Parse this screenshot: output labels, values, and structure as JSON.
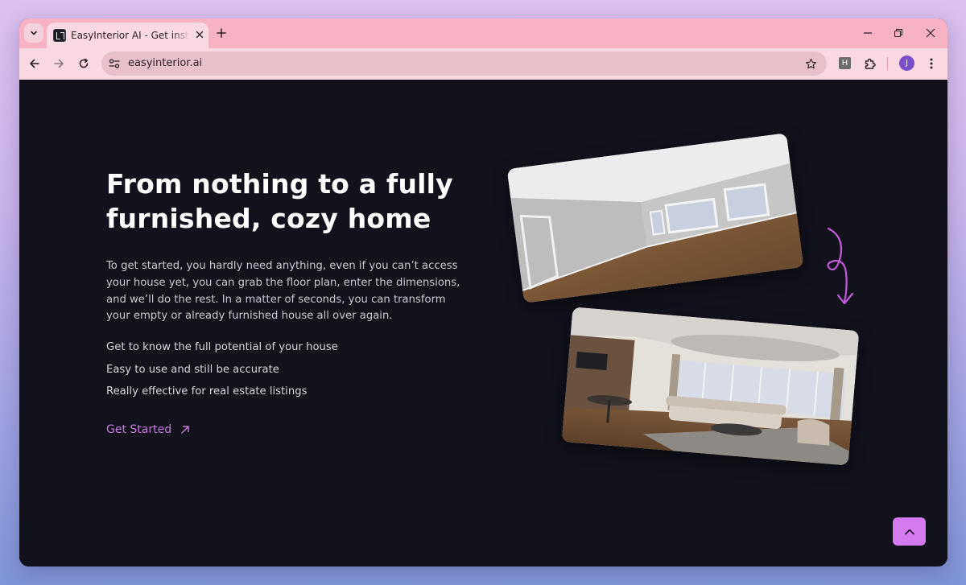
{
  "browser": {
    "tab": {
      "title": "EasyInterior AI - Get instant interior design"
    },
    "address_bar": {
      "url": "easyinterior.ai"
    },
    "extension_label": "H",
    "profile_initial": "J"
  },
  "hero": {
    "title": "From nothing to a fully furnished, cozy home",
    "description": "To get started, you hardly need anything, even if you can’t access your house yet, you can grab the floor plan, enter the dimensions, and we’ll do the rest. In a matter of seconds, you can transform your empty or already furnished house all over again.",
    "features": [
      "Get to know the full potential of your house",
      "Easy to use and still be accurate",
      "Really effective for real estate listings"
    ],
    "cta_label": "Get Started"
  },
  "colors": {
    "page_background": "#12121d",
    "accent": "#c77ae0",
    "scroll_top_button": "#d57bf0",
    "tab_bar": "#f7b3c4",
    "toolbar": "#fbd9e2"
  },
  "icons": {
    "tab_search": "chevron-down-icon",
    "favicon": "easyinterior-logo-icon",
    "tab_close": "close-icon",
    "new_tab": "plus-icon",
    "minimize": "minimize-icon",
    "restore": "restore-icon",
    "close_window": "close-icon",
    "back": "arrow-left-icon",
    "forward": "arrow-right-icon",
    "reload": "reload-icon",
    "site_info": "tune-icon",
    "bookmark": "star-icon",
    "extensions": "puzzle-icon",
    "menu": "kebab-menu-icon",
    "cta": "arrow-up-right-icon",
    "scroll_top": "chevron-up-icon",
    "decoration": "curly-arrow-down-icon"
  }
}
